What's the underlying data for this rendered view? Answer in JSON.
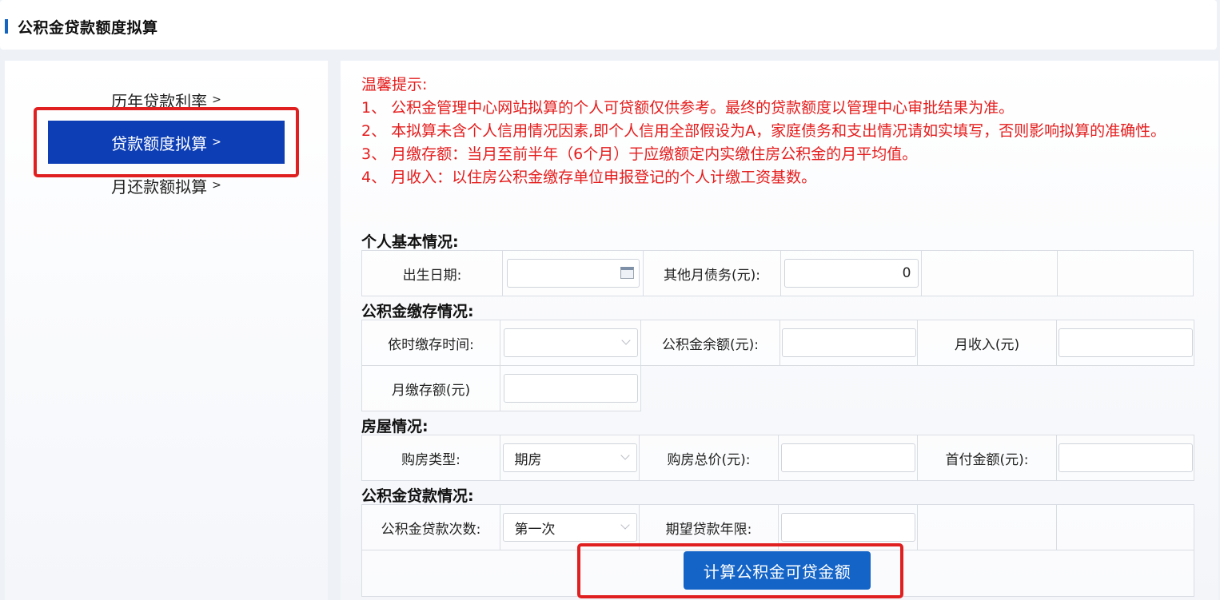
{
  "header": {
    "title": "公积金贷款额度拟算"
  },
  "sidebar": {
    "items": [
      {
        "label": "历年贷款利率",
        "arrow": ">"
      },
      {
        "label": "贷款额度拟算",
        "arrow": ">"
      },
      {
        "label": "月还款额拟算",
        "arrow": ">"
      }
    ]
  },
  "notice": {
    "heading": "温馨提示:",
    "lines": [
      "1、 公积金管理中心网站拟算的个人可贷额仅供参考。最终的贷款额度以管理中心审批结果为准。",
      "2、 本拟算未含个人信用情况因素,即个人信用全部假设为A，家庭债务和支出情况请如实填写，否则影响拟算的准确性。",
      "3、 月缴存额：当月至前半年（6个月）于应缴额定内实缴住房公积金的月平均值。",
      "4、 月收入：以住房公积金缴存单位申报登记的个人计缴工资基数。"
    ]
  },
  "sections": {
    "personal": {
      "title": "个人基本情况:",
      "birth_label": "出生日期:",
      "birth_value": "",
      "debt_label": "其他月债务(元):",
      "debt_value": "0"
    },
    "deposit": {
      "title": "公积金缴存情况:",
      "time_label": "依时缴存时间:",
      "time_value": "",
      "balance_label": "公积金余额(元):",
      "balance_value": "",
      "income_label": "月收入(元)",
      "income_value": "",
      "monthly_label": "月缴存额(元)",
      "monthly_value": ""
    },
    "house": {
      "title": "房屋情况:",
      "type_label": "购房类型:",
      "type_value": "期房",
      "price_label": "购房总价(元):",
      "price_value": "",
      "down_label": "首付金额(元):",
      "down_value": ""
    },
    "loan": {
      "title": "公积金贷款情况:",
      "count_label": "公积金贷款次数:",
      "count_value": "第一次",
      "years_label": "期望贷款年限:",
      "years_value": ""
    }
  },
  "calc_button": "计算公积金可贷金额"
}
